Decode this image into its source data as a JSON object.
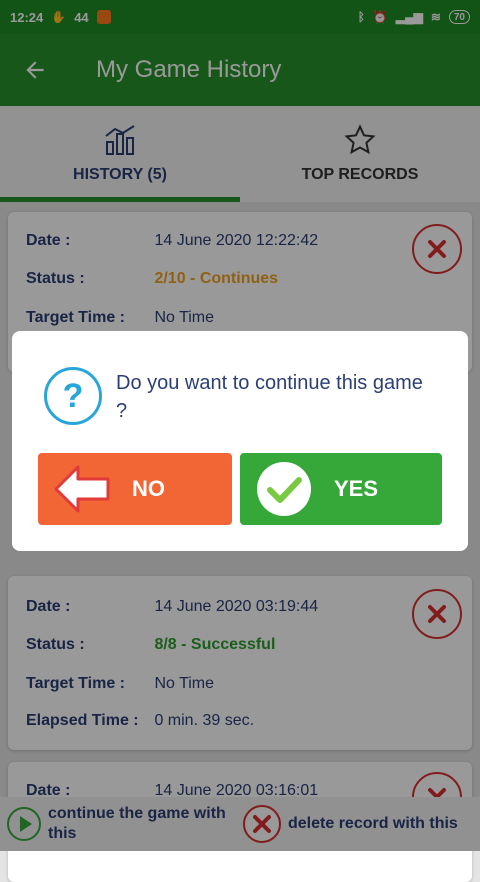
{
  "status_bar": {
    "time": "12:24",
    "icon_left": [
      "hand-icon",
      "44"
    ],
    "battery": "70"
  },
  "app_bar": {
    "title": "My Game History"
  },
  "tabs": [
    {
      "label": "HISTORY (5)",
      "icon": "chart-icon",
      "active": true
    },
    {
      "label": "TOP RECORDS",
      "icon": "star-icon",
      "active": false
    }
  ],
  "records": [
    {
      "date_label": "Date :",
      "date_value": "14 June 2020 12:22:42",
      "status_label": "Status :",
      "status_value": "2/10 - Continues",
      "target_label": "Target Time :",
      "target_value": "No Time"
    },
    {
      "date_label": "Date :",
      "date_value": "14 June 2020 03:19:44",
      "status_label": "Status :",
      "status_value": "8/8 - Successful",
      "target_label": "Target Time :",
      "target_value": "No Time",
      "elapsed_label": "Elapsed Time :",
      "elapsed_value": "0 min. 39 sec."
    },
    {
      "date_label": "Date :",
      "date_value": "14 June 2020 03:16:01"
    }
  ],
  "dialog": {
    "message": "Do you want to continue this game ?",
    "no_label": "NO",
    "yes_label": "YES"
  },
  "legend": {
    "continue_text": "continue the game with this",
    "delete_text": "delete record with this"
  },
  "colors": {
    "primary_green": "#27922b",
    "status_continues": "#f0a020",
    "status_success": "#2e9d2e",
    "no_button": "#f26535",
    "yes_button": "#36a83a"
  }
}
